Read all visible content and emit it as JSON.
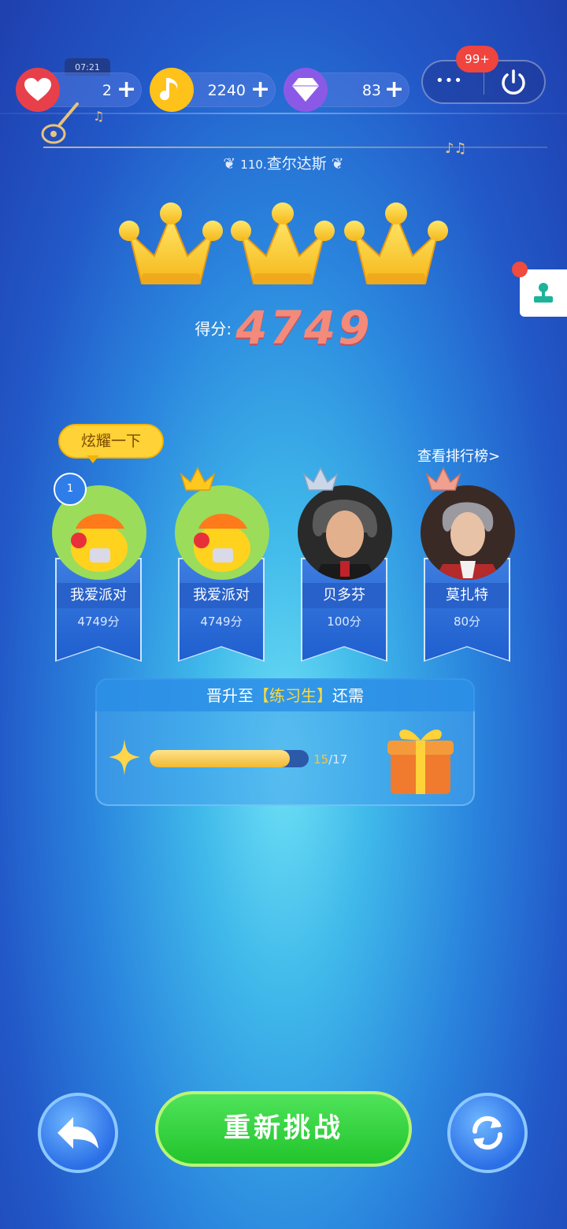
{
  "status_bar": {
    "time": "07:21"
  },
  "resources": {
    "lives": {
      "value": "2",
      "add": "+"
    },
    "notes": {
      "value": "2240",
      "add": "+"
    },
    "gems": {
      "value": "83",
      "add": "+"
    }
  },
  "menu": {
    "more_label": "•••",
    "badge": "99+"
  },
  "level": {
    "number": "110.",
    "name": "查尔达斯"
  },
  "result": {
    "crowns_earned": 3,
    "crowns_total": 3,
    "score_label": "得分:",
    "score": "4749"
  },
  "leaderboard": {
    "show_off_label": "炫耀一下",
    "view_link": "查看排行榜>",
    "players": [
      {
        "rank": "1",
        "name": "我爱派对",
        "score": "4749分"
      },
      {
        "name": "我爱派对",
        "score": "4749分"
      },
      {
        "name": "贝多芬",
        "score": "100分"
      },
      {
        "name": "莫扎特",
        "score": "80分"
      }
    ]
  },
  "promotion": {
    "prefix": "晋升至",
    "target": "【练习生】",
    "suffix": "还需",
    "current": "15",
    "total": "/17",
    "progress_fraction": 0.882
  },
  "bottom_bar": {
    "retry_label": "重新挑战"
  },
  "colors": {
    "retry_green": "#22c42c",
    "score_pink": "#f48a7a",
    "badge_red": "#f0443e"
  }
}
